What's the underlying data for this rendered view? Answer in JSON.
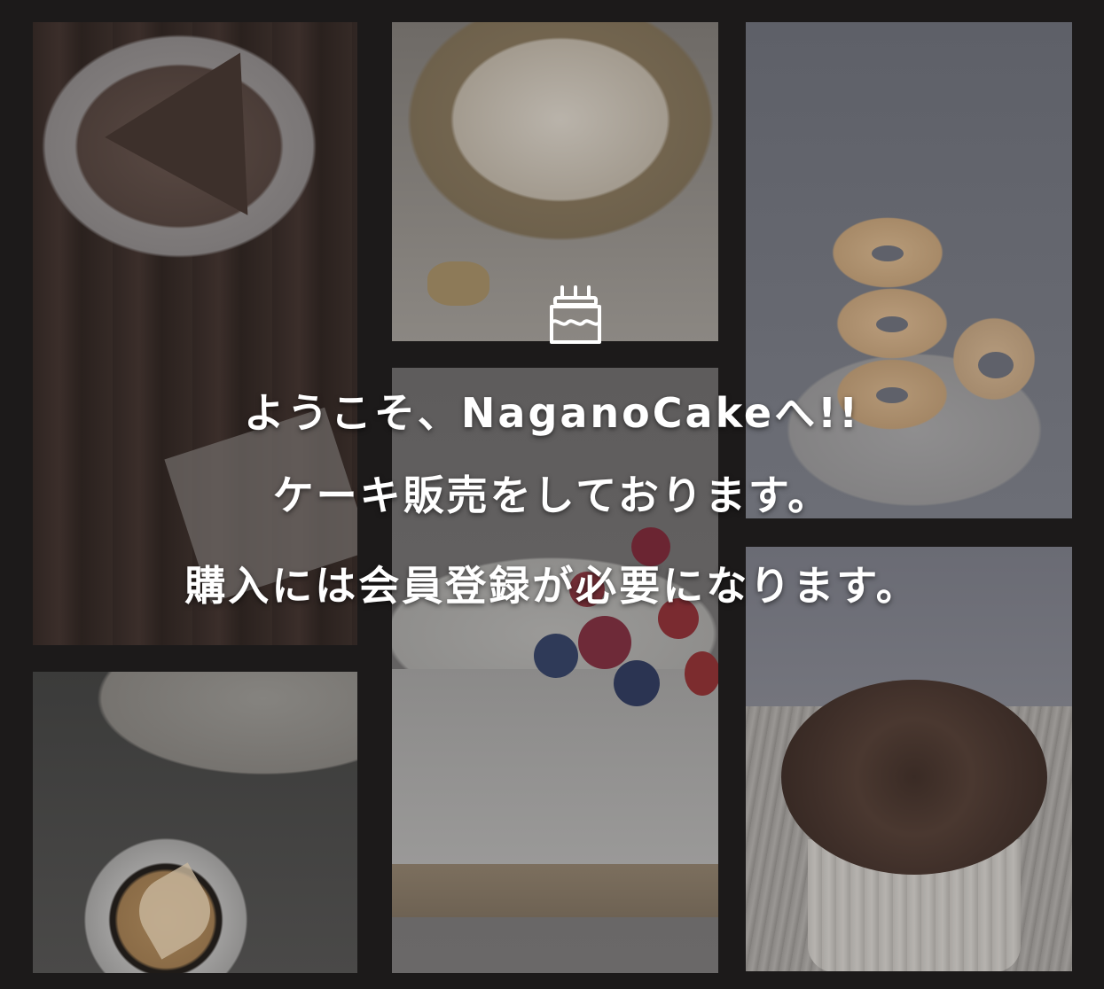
{
  "hero": {
    "icon": "birthday-cake-icon",
    "lines": [
      "ようこそ、NaganoCakeへ!!",
      "ケーキ販売をしております。",
      "購入には会員登録が必要になります。"
    ]
  },
  "colors": {
    "background": "#1c1a1a",
    "text": "#ffffff"
  },
  "gallery": {
    "images": [
      "chocolate-cake-image",
      "lemon-meringue-tart-image",
      "donuts-image",
      "latte-coffee-image",
      "berry-cheesecake-image",
      "chocolate-cupcake-image"
    ]
  }
}
